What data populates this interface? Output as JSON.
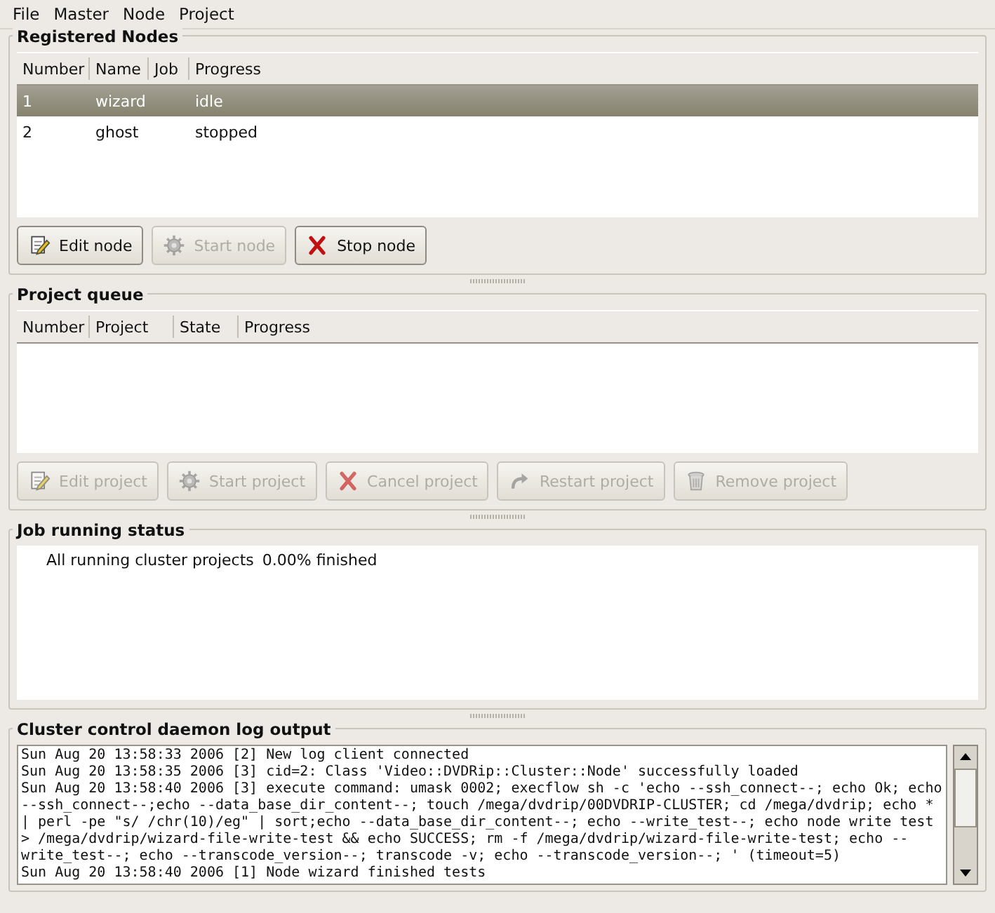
{
  "menu": [
    "File",
    "Master",
    "Node",
    "Project"
  ],
  "nodes": {
    "title": "Registered Nodes",
    "columns": [
      "Number",
      "Name",
      "Job",
      "Progress"
    ],
    "rows": [
      {
        "number": "1",
        "name": "wizard",
        "progress": "idle",
        "selected": true
      },
      {
        "number": "2",
        "name": "ghost",
        "progress": "stopped",
        "selected": false
      }
    ],
    "buttons": [
      {
        "label": "Edit node",
        "kind": "edit",
        "disabled": false
      },
      {
        "label": "Start node",
        "kind": "start",
        "disabled": true
      },
      {
        "label": "Stop node",
        "kind": "stop",
        "disabled": false
      }
    ]
  },
  "queue": {
    "title": "Project queue",
    "columns": [
      "Number",
      "Project",
      "State",
      "Progress"
    ],
    "buttons": [
      {
        "label": "Edit project",
        "kind": "edit",
        "disabled": true
      },
      {
        "label": "Start project",
        "kind": "start",
        "disabled": true
      },
      {
        "label": "Cancel project",
        "kind": "stop",
        "disabled": true
      },
      {
        "label": "Restart project",
        "kind": "restart",
        "disabled": true
      },
      {
        "label": "Remove project",
        "kind": "remove",
        "disabled": true
      }
    ]
  },
  "job_status": {
    "title": "Job running status",
    "label": "All running cluster projects",
    "value": "0.00% finished"
  },
  "log": {
    "title": "Cluster control daemon log output",
    "lines": [
      "Sun Aug 20 13:58:33 2006 [2] New log client connected",
      "Sun Aug 20 13:58:35 2006 [3] cid=2: Class 'Video::DVDRip::Cluster::Node' successfully loaded",
      "Sun Aug 20 13:58:40 2006 [3] execute command: umask 0002; execflow sh -c 'echo --ssh_connect--; echo Ok; echo",
      "--ssh_connect--;echo --data_base_dir_content--; touch /mega/dvdrip/00DVDRIP-CLUSTER; cd /mega/dvdrip; echo *",
      "| perl -pe \"s/ /chr(10)/eg\" | sort;echo --data_base_dir_content--; echo --write_test--; echo node write test",
      "> /mega/dvdrip/wizard-file-write-test && echo SUCCESS; rm -f /mega/dvdrip/wizard-file-write-test; echo --",
      "write_test--; echo --transcode_version--; transcode -v; echo --transcode_version--; ' (timeout=5)",
      "Sun Aug 20 13:58:40 2006 [1] Node wizard finished tests"
    ]
  }
}
